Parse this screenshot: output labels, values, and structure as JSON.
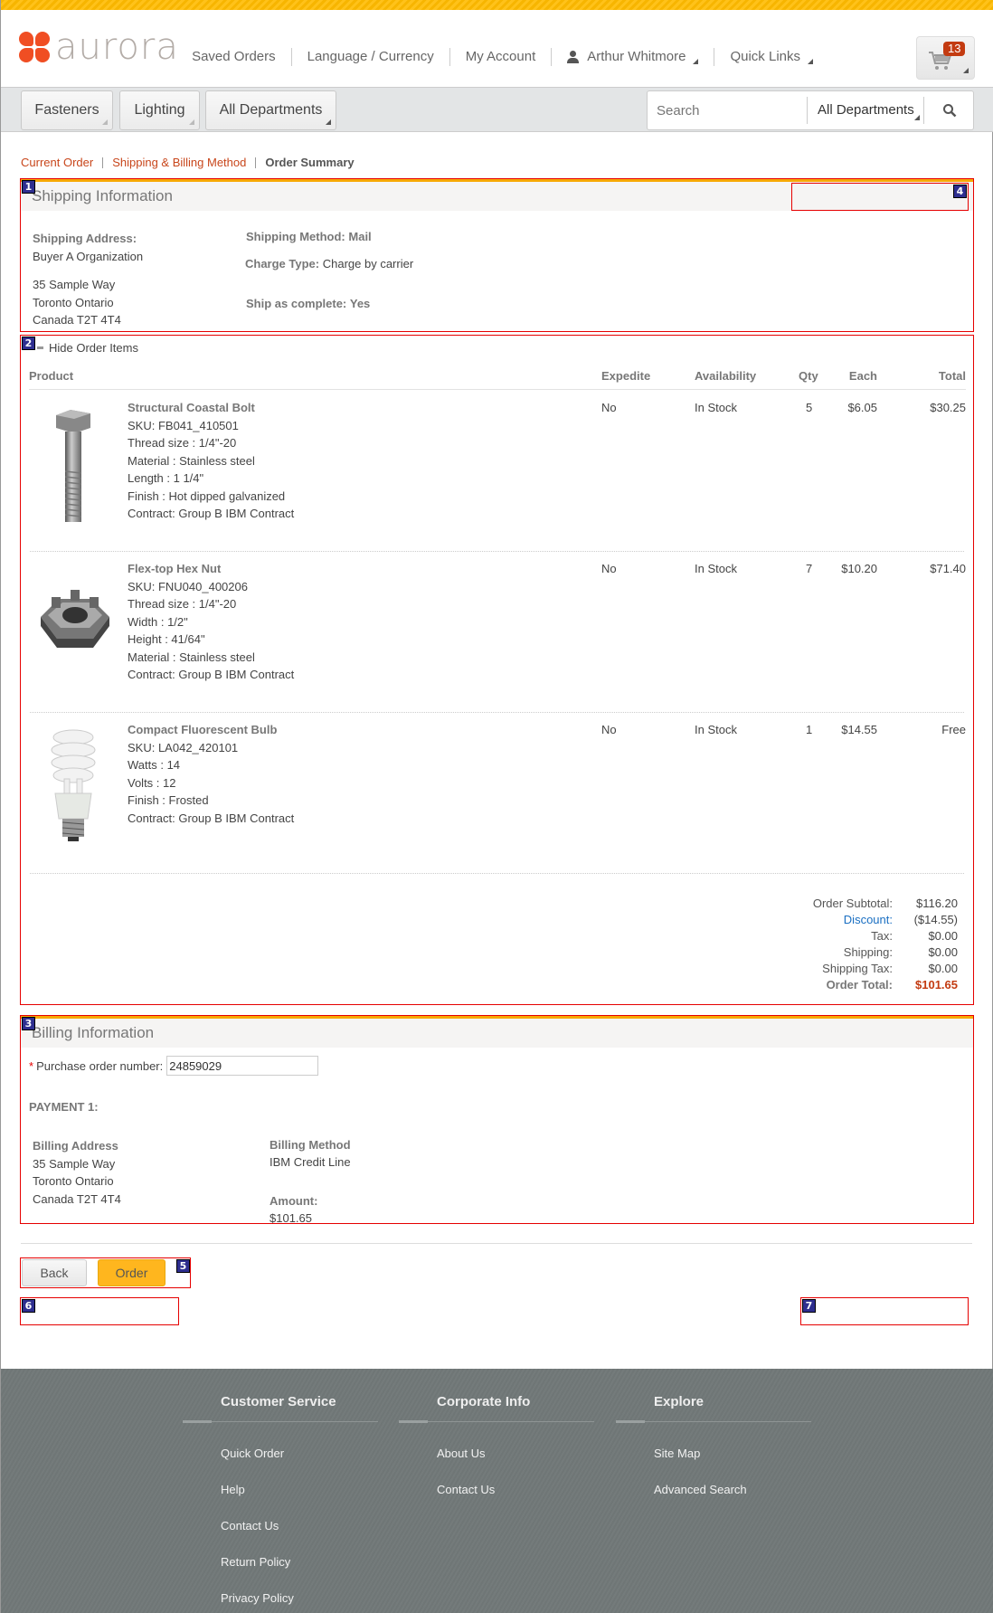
{
  "header": {
    "logo_text": "aurora",
    "links": [
      "Saved Orders",
      "Language / Currency",
      "My Account"
    ],
    "user_name": "Arthur Whitmore",
    "quick_links": "Quick Links",
    "cart_count": "13"
  },
  "navbar": {
    "departments": [
      "Fasteners",
      "Lighting",
      "All Departments"
    ],
    "search_placeholder": "Search",
    "search_department": "All Departments"
  },
  "breadcrumb": [
    "Current Order",
    "Shipping & Billing Method",
    "Order Summary"
  ],
  "shipping": {
    "title": "Shipping Information",
    "address_label": "Shipping Address:",
    "address_name": "Buyer A Organization",
    "address_lines": [
      "35 Sample Way",
      "Toronto Ontario",
      "Canada T2T 4T4"
    ],
    "method_label": "Shipping Method:",
    "method_value": "Mail",
    "charge_label": "Charge Type:",
    "charge_value": "Charge by carrier",
    "complete_label": "Ship as complete:",
    "complete_value": "Yes"
  },
  "items": {
    "toggle_label": "Hide Order Items",
    "columns": [
      "Product",
      "Expedite",
      "Availability",
      "Qty",
      "Each",
      "Total"
    ],
    "rows": [
      {
        "name": "Structural Coastal Bolt",
        "details": [
          "SKU: FB041_410501",
          "Thread size : 1/4\"-20",
          "Material : Stainless steel",
          "Length : 1 1/4\"",
          "Finish : Hot dipped galvanized",
          "Contract: Group B IBM Contract"
        ],
        "expedite": "No",
        "availability": "In Stock",
        "qty": "5",
        "each": "$6.05",
        "total": "$30.25"
      },
      {
        "name": "Flex-top Hex Nut",
        "details": [
          "SKU: FNU040_400206",
          "Thread size : 1/4\"-20",
          "Width : 1/2\"",
          "Height : 41/64\"",
          "Material : Stainless steel",
          "Contract: Group B IBM Contract"
        ],
        "expedite": "No",
        "availability": "In Stock",
        "qty": "7",
        "each": "$10.20",
        "total": "$71.40"
      },
      {
        "name": "Compact Fluorescent Bulb",
        "details": [
          "SKU: LA042_420101",
          "Watts : 14",
          "Volts : 12",
          "Finish : Frosted",
          "Contract: Group B IBM Contract"
        ],
        "expedite": "No",
        "availability": "In Stock",
        "qty": "1",
        "each": "$14.55",
        "total": "Free"
      }
    ],
    "totals": {
      "subtotal_label": "Order Subtotal:",
      "subtotal": "$116.20",
      "discount_label": "Discount:",
      "discount": "($14.55)",
      "tax_label": "Tax:",
      "tax": "$0.00",
      "shipping_label": "Shipping:",
      "shipping": "$0.00",
      "shipping_tax_label": "Shipping Tax:",
      "shipping_tax": "$0.00",
      "total_label": "Order Total:",
      "total": "$101.65"
    }
  },
  "billing": {
    "title": "Billing Information",
    "po_required_mark": "*",
    "po_label": "Purchase order number:",
    "po_value": "24859029",
    "payment_label": "PAYMENT 1:",
    "address_label": "Billing Address",
    "address_lines": [
      "35 Sample Way",
      "Toronto Ontario",
      "Canada T2T 4T4"
    ],
    "method_label": "Billing Method",
    "method_value": "IBM Credit Line",
    "amount_label": "Amount:",
    "amount_value": "$101.65"
  },
  "actions": {
    "back": "Back",
    "order": "Order"
  },
  "markers": [
    "1",
    "2",
    "3",
    "4",
    "5",
    "6",
    "7"
  ],
  "footer": {
    "columns": [
      {
        "title": "Customer Service",
        "links": [
          "Quick Order",
          "Help",
          "Contact Us",
          "Return Policy",
          "Privacy Policy"
        ]
      },
      {
        "title": "Corporate Info",
        "links": [
          "About Us",
          "Contact Us"
        ]
      },
      {
        "title": "Explore",
        "links": [
          "Site Map",
          "Advanced Search"
        ]
      }
    ]
  },
  "colors": {
    "accent": "#f7a800",
    "brand": "#f04e23",
    "link": "#c8461b",
    "total": "#c33b11",
    "discount": "#1a6fc2",
    "order_button": "#ffb61e"
  }
}
